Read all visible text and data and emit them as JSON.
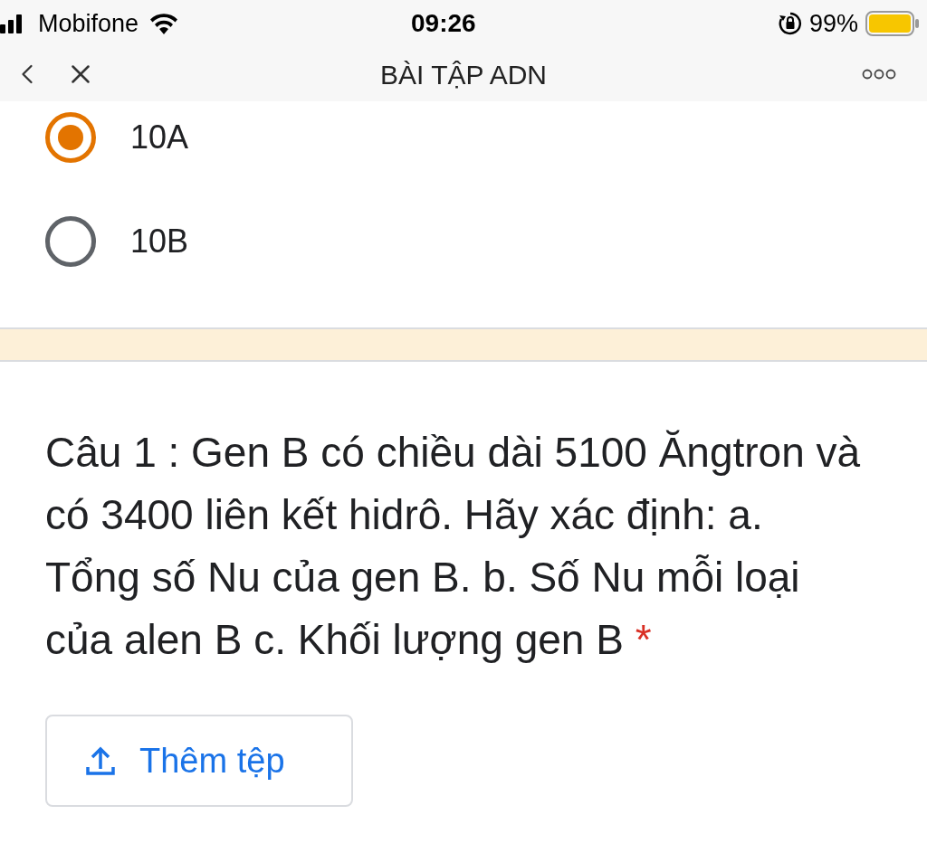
{
  "status_bar": {
    "carrier": "Mobifone",
    "time": "09:26",
    "battery": "99%"
  },
  "nav": {
    "title": "BÀI TẬP ADN"
  },
  "options": [
    {
      "label": "10A",
      "selected": true
    },
    {
      "label": "10B",
      "selected": false
    }
  ],
  "question": {
    "text": "Câu 1 : Gen B có chiều dài 5100 Ăngtron và có 3400 liên kết hidrô. Hãy xác định: a. Tổng số Nu của gen B. b. Số Nu mỗi loại của alen B c. Khối lượng gen B",
    "required_mark": "*"
  },
  "upload_button": {
    "label": "Thêm tệp"
  }
}
